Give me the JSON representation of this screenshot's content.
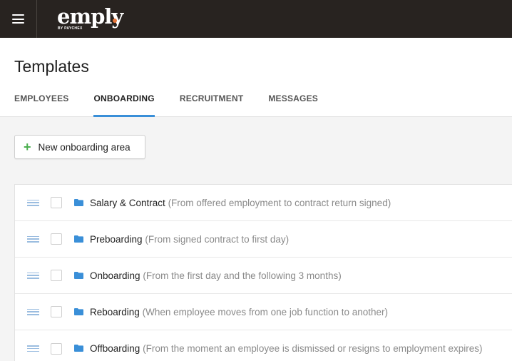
{
  "app": {
    "logo_text": "emply",
    "logo_sub": "BY PAYCHEX",
    "accent_color": "#e8773a"
  },
  "page": {
    "title": "Templates",
    "tabs": [
      {
        "label": "EMPLOYEES",
        "active": false
      },
      {
        "label": "ONBOARDING",
        "active": true
      },
      {
        "label": "RECRUITMENT",
        "active": false
      },
      {
        "label": "MESSAGES",
        "active": false
      }
    ]
  },
  "toolbar": {
    "new_button_label": "New onboarding area",
    "plus_color": "#4caf50"
  },
  "areas": [
    {
      "name": "Salary & Contract",
      "description": "(From offered employment to contract return signed)"
    },
    {
      "name": "Preboarding",
      "description": "(From signed contract to first day)"
    },
    {
      "name": "Onboarding",
      "description": "(From the first day and the following 3 months)"
    },
    {
      "name": "Reboarding",
      "description": "(When employee moves from one job function to another)"
    },
    {
      "name": "Offboarding",
      "description": "(From the moment an employee is dismissed or resigns to employment expires)"
    }
  ],
  "colors": {
    "topbar": "#282320",
    "tab_underline": "#3a8fd8",
    "folder_icon": "#3a8fd8"
  }
}
